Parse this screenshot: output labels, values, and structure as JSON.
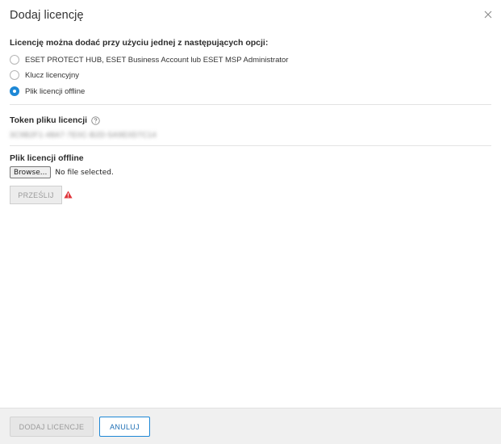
{
  "dialog": {
    "title": "Dodaj licencję"
  },
  "options": {
    "label": "Licencję można dodać przy użyciu jednej z następujących opcji:",
    "items": [
      {
        "label": "ESET PROTECT HUB, ESET Business Account lub ESET MSP Administrator",
        "checked": false
      },
      {
        "label": "Klucz licencyjny",
        "checked": false
      },
      {
        "label": "Plik licencji offline",
        "checked": true
      }
    ]
  },
  "token": {
    "label": "Token pliku licencji",
    "value": "3C9B2F1-48A7-7E0C-B2D-5A9E0D7C14"
  },
  "offline_file": {
    "label": "Plik licencji offline",
    "browse_label": "Browse...",
    "status": "No file selected."
  },
  "send_button": "PRZEŚLIJ",
  "footer": {
    "add_label": "DODAJ LICENCJE",
    "cancel_label": "ANULUJ"
  },
  "colors": {
    "accent": "#1e88d6",
    "warning": "#e0353b"
  },
  "icons": {
    "close": "close-icon",
    "help": "help-icon",
    "warning": "warning-icon"
  }
}
